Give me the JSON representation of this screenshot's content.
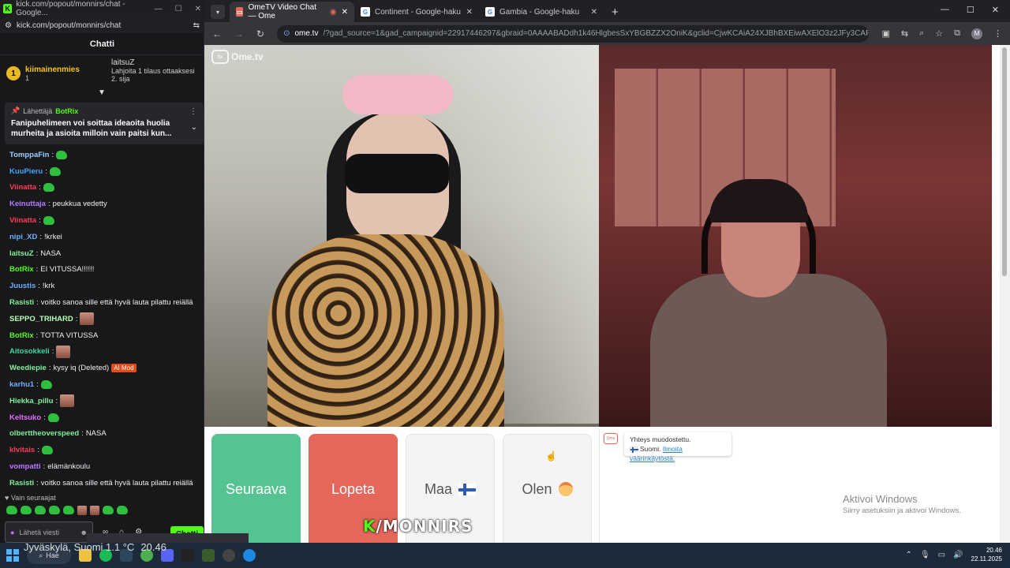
{
  "chat_window": {
    "title": "kick.com/popout/monnirs/chat - Google...",
    "url": "kick.com/popout/monnirs/chat",
    "header": "Chatti",
    "leaderboard": [
      {
        "name": "kiimainenmies",
        "count": "1",
        "rank": "1"
      },
      {
        "name": "laitsuZ",
        "count": "1",
        "note": "Lahjoita 1 tilaus ottaaksesi 2. sija"
      }
    ],
    "pinned": {
      "label": "Lähettäjä",
      "sender": "BotRix",
      "text": "Fanipuhelimeen voi soittaa ideaoita huolia murheita ja asioita milloin vain paitsi kun..."
    },
    "messages": [
      {
        "user": "TomppaFin",
        "color": "#9ad0ff",
        "text": "",
        "emote": true
      },
      {
        "user": "KuuPieru",
        "color": "#3fa7ff",
        "text": "",
        "emote": true
      },
      {
        "user": "Viinatta",
        "color": "#ff3b5c",
        "text": "",
        "emote": true
      },
      {
        "user": "Keinuttaja",
        "color": "#b57bff",
        "text": "peukkua vedetty"
      },
      {
        "user": "Viinatta",
        "color": "#ff3b5c",
        "text": "",
        "emote": true
      },
      {
        "user": "nipi_XD",
        "color": "#6fb0ff",
        "text": "!krkei"
      },
      {
        "user": "laitsuZ",
        "color": "#7df09a",
        "text": "NASA"
      },
      {
        "user": "BotRix",
        "color": "#53fc18",
        "text": "EI VITUSSA!!!!!!"
      },
      {
        "user": "Juustis",
        "color": "#6fb0ff",
        "text": "!krk"
      },
      {
        "user": "Rasisti",
        "color": "#7df09a",
        "text": "voitko sanoa sille että hyvä lauta pilattu reiällä"
      },
      {
        "user": "SEPPO_TRIHARD",
        "color": "#b4ffb4",
        "text": "",
        "face": true
      },
      {
        "user": "BotRix",
        "color": "#53fc18",
        "text": "TOTTA VITUSSA"
      },
      {
        "user": "Aitosokkeli",
        "color": "#3fd4a0",
        "text": "",
        "face": true
      },
      {
        "user": "Weediepie",
        "color": "#7df09a",
        "text": "kysy iq (Deleted)",
        "tag": "AI Mod"
      },
      {
        "user": "karhu1",
        "color": "#6fb0ff",
        "text": "",
        "emote": true
      },
      {
        "user": "Hiekka_pillu",
        "color": "#7df09a",
        "text": "",
        "face": true
      },
      {
        "user": "Keltsuko",
        "color": "#e86bff",
        "text": "",
        "emote": true
      },
      {
        "user": "olberttheoverspeed",
        "color": "#7df09a",
        "text": "NASA"
      },
      {
        "user": "klvitais",
        "color": "#ff3b5c",
        "text": "",
        "emote": true
      },
      {
        "user": "vompatti",
        "color": "#b57bff",
        "text": "elämänkoulu"
      },
      {
        "user": "Rasisti",
        "color": "#7df09a",
        "text": "voitko sanoa sille että hyvä lauta pilattu reiällä"
      }
    ],
    "follow_only": "Vain seuraajat",
    "input_placeholder": "Lähetä viesti",
    "send_label": "Chatti"
  },
  "browser": {
    "tabs": [
      {
        "title": "OmeTV Video Chat — Ome",
        "active": true
      },
      {
        "title": "Continent - Google-haku",
        "active": false
      },
      {
        "title": "Gambia - Google-haku",
        "active": false
      }
    ],
    "url_host": "ome.tv",
    "url_path": "/?gad_source=1&gad_campaignid=22917446297&gbraid=0AAAABADdh1k46HlgbesSxYBGBZZX2OniK&gclid=CjwKCAiA24XJBhBXEiwAXElO3z2JFy3CAFEtMPQmJzthP...",
    "profile_initial": "M"
  },
  "ometv": {
    "logo": "Ome.tv",
    "buttons": {
      "next": "Seuraava",
      "stop": "Lopeta",
      "country": "Maa",
      "gender": "Olen"
    },
    "connection_message": "Yhteys muodostettu.",
    "country_line": "Suomi.",
    "report_link": "Ilmoita väärinkäytöstä."
  },
  "windows_activation": {
    "title": "Aktivoi Windows",
    "subtitle": "Siirry asetuksiin ja aktivoi Windows."
  },
  "watermark": {
    "k": "K",
    "text": "/MONNIRS"
  },
  "taskbar": {
    "search": "Hae",
    "weather": "Jyväskylä, Suomi  1.1 °C",
    "weather_time": "20.46",
    "time": "20.46",
    "date": "22.11.2025"
  }
}
